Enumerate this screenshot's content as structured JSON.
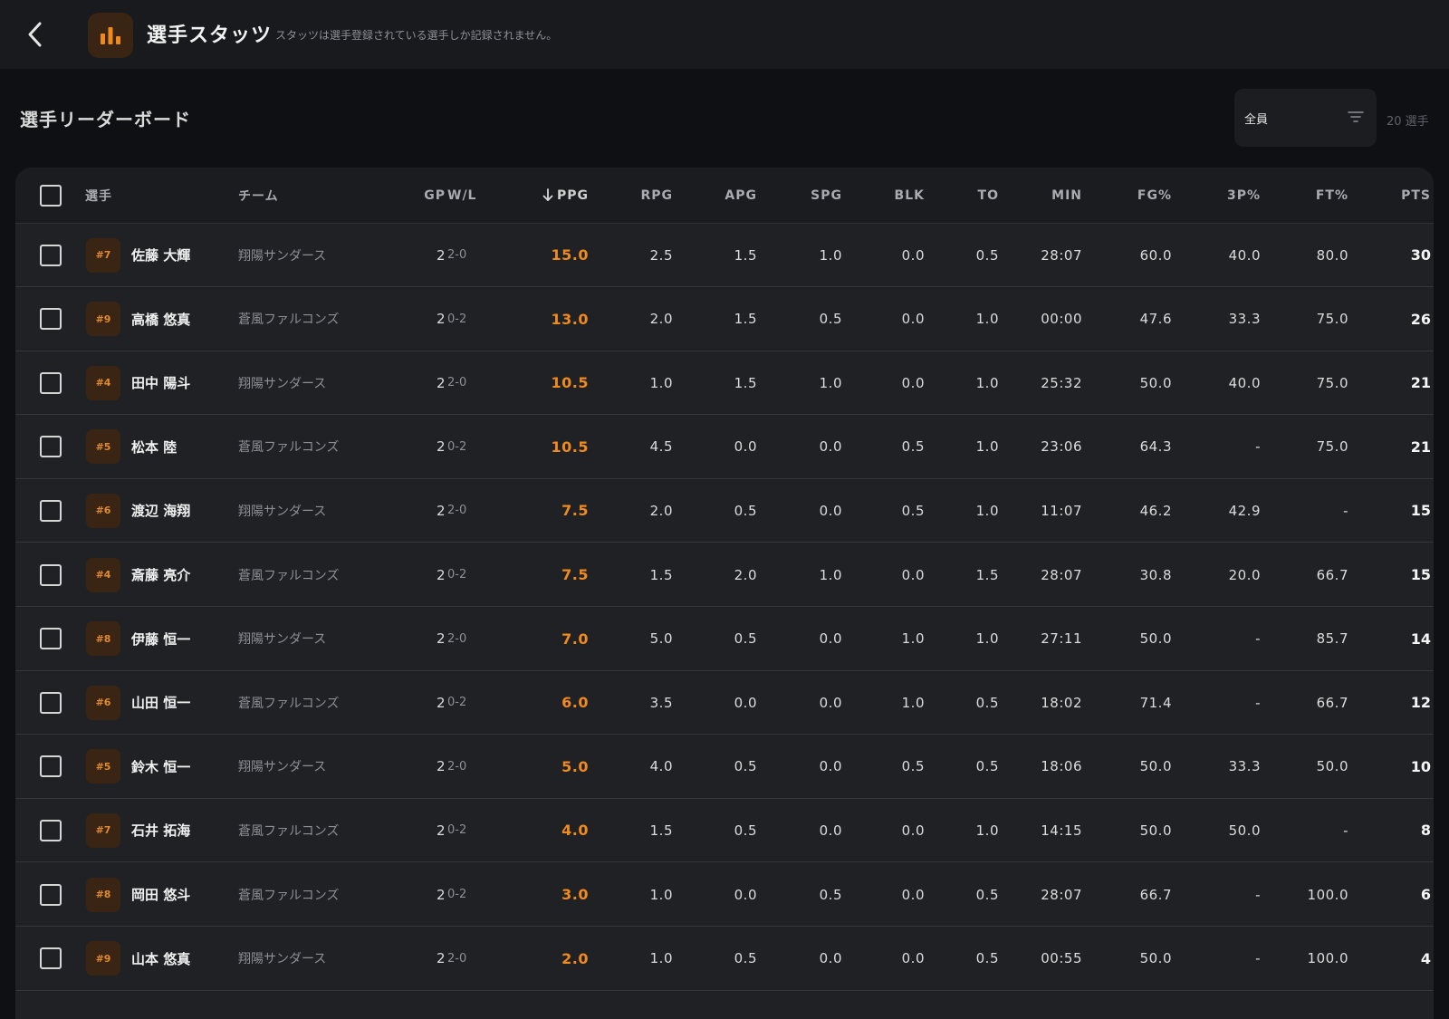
{
  "header": {
    "title": "選手スタッツ",
    "subtitle": "スタッツは選手登録されている選手しか記録されません。",
    "accent": "#f08a1c",
    "icons": {
      "back": "chevron-left-icon",
      "app": "bar-chart-icon"
    }
  },
  "leaderboard": {
    "title": "選手リーダーボード",
    "filter_value": "全員",
    "filter_icon": "filter-icon",
    "count_label": "20 選手"
  },
  "table": {
    "headers": {
      "player": "選手",
      "team": "チーム",
      "gp": "GP",
      "wl": "W/L",
      "ppg": "PPG",
      "rpg": "RPG",
      "apg": "APG",
      "spg": "SPG",
      "blk": "BLK",
      "to": "TO",
      "min": "MIN",
      "fg": "FG%",
      "tp": "3P%",
      "ft": "FT%",
      "pts": "PTS"
    },
    "sort_column": "ppg",
    "sort_direction": "descending",
    "rows": [
      {
        "number": "#7",
        "name": "佐藤 大輝",
        "team": "翔陽サンダース",
        "gp": "2",
        "wl": "2-0",
        "ppg": "15.0",
        "rpg": "2.5",
        "apg": "1.5",
        "spg": "1.0",
        "blk": "0.0",
        "to": "0.5",
        "min": "28:07",
        "fg": "60.0",
        "tp": "40.0",
        "ft": "80.0",
        "pts": "30"
      },
      {
        "number": "#9",
        "name": "高橋 悠真",
        "team": "蒼風ファルコンズ",
        "gp": "2",
        "wl": "0-2",
        "ppg": "13.0",
        "rpg": "2.0",
        "apg": "1.5",
        "spg": "0.5",
        "blk": "0.0",
        "to": "1.0",
        "min": "00:00",
        "fg": "47.6",
        "tp": "33.3",
        "ft": "75.0",
        "pts": "26"
      },
      {
        "number": "#4",
        "name": "田中 陽斗",
        "team": "翔陽サンダース",
        "gp": "2",
        "wl": "2-0",
        "ppg": "10.5",
        "rpg": "1.0",
        "apg": "1.5",
        "spg": "1.0",
        "blk": "0.0",
        "to": "1.0",
        "min": "25:32",
        "fg": "50.0",
        "tp": "40.0",
        "ft": "75.0",
        "pts": "21"
      },
      {
        "number": "#5",
        "name": "松本 陸",
        "team": "蒼風ファルコンズ",
        "gp": "2",
        "wl": "0-2",
        "ppg": "10.5",
        "rpg": "4.5",
        "apg": "0.0",
        "spg": "0.0",
        "blk": "0.5",
        "to": "1.0",
        "min": "23:06",
        "fg": "64.3",
        "tp": "-",
        "ft": "75.0",
        "pts": "21"
      },
      {
        "number": "#6",
        "name": "渡辺 海翔",
        "team": "翔陽サンダース",
        "gp": "2",
        "wl": "2-0",
        "ppg": "7.5",
        "rpg": "2.0",
        "apg": "0.5",
        "spg": "0.0",
        "blk": "0.5",
        "to": "1.0",
        "min": "11:07",
        "fg": "46.2",
        "tp": "42.9",
        "ft": "-",
        "pts": "15"
      },
      {
        "number": "#4",
        "name": "斎藤 亮介",
        "team": "蒼風ファルコンズ",
        "gp": "2",
        "wl": "0-2",
        "ppg": "7.5",
        "rpg": "1.5",
        "apg": "2.0",
        "spg": "1.0",
        "blk": "0.0",
        "to": "1.5",
        "min": "28:07",
        "fg": "30.8",
        "tp": "20.0",
        "ft": "66.7",
        "pts": "15"
      },
      {
        "number": "#8",
        "name": "伊藤 恒一",
        "team": "翔陽サンダース",
        "gp": "2",
        "wl": "2-0",
        "ppg": "7.0",
        "rpg": "5.0",
        "apg": "0.5",
        "spg": "0.0",
        "blk": "1.0",
        "to": "1.0",
        "min": "27:11",
        "fg": "50.0",
        "tp": "-",
        "ft": "85.7",
        "pts": "14"
      },
      {
        "number": "#6",
        "name": "山田 恒一",
        "team": "蒼風ファルコンズ",
        "gp": "2",
        "wl": "0-2",
        "ppg": "6.0",
        "rpg": "3.5",
        "apg": "0.0",
        "spg": "0.0",
        "blk": "1.0",
        "to": "0.5",
        "min": "18:02",
        "fg": "71.4",
        "tp": "-",
        "ft": "66.7",
        "pts": "12"
      },
      {
        "number": "#5",
        "name": "鈴木 恒一",
        "team": "翔陽サンダース",
        "gp": "2",
        "wl": "2-0",
        "ppg": "5.0",
        "rpg": "4.0",
        "apg": "0.5",
        "spg": "0.0",
        "blk": "0.5",
        "to": "0.5",
        "min": "18:06",
        "fg": "50.0",
        "tp": "33.3",
        "ft": "50.0",
        "pts": "10"
      },
      {
        "number": "#7",
        "name": "石井 拓海",
        "team": "蒼風ファルコンズ",
        "gp": "2",
        "wl": "0-2",
        "ppg": "4.0",
        "rpg": "1.5",
        "apg": "0.5",
        "spg": "0.0",
        "blk": "0.0",
        "to": "1.0",
        "min": "14:15",
        "fg": "50.0",
        "tp": "50.0",
        "ft": "-",
        "pts": "8"
      },
      {
        "number": "#8",
        "name": "岡田 悠斗",
        "team": "蒼風ファルコンズ",
        "gp": "2",
        "wl": "0-2",
        "ppg": "3.0",
        "rpg": "1.0",
        "apg": "0.0",
        "spg": "0.5",
        "blk": "0.0",
        "to": "0.5",
        "min": "28:07",
        "fg": "66.7",
        "tp": "-",
        "ft": "100.0",
        "pts": "6"
      },
      {
        "number": "#9",
        "name": "山本 悠真",
        "team": "翔陽サンダース",
        "gp": "2",
        "wl": "2-0",
        "ppg": "2.0",
        "rpg": "1.0",
        "apg": "0.5",
        "spg": "0.0",
        "blk": "0.0",
        "to": "0.5",
        "min": "00:55",
        "fg": "50.0",
        "tp": "-",
        "ft": "100.0",
        "pts": "4"
      }
    ]
  }
}
